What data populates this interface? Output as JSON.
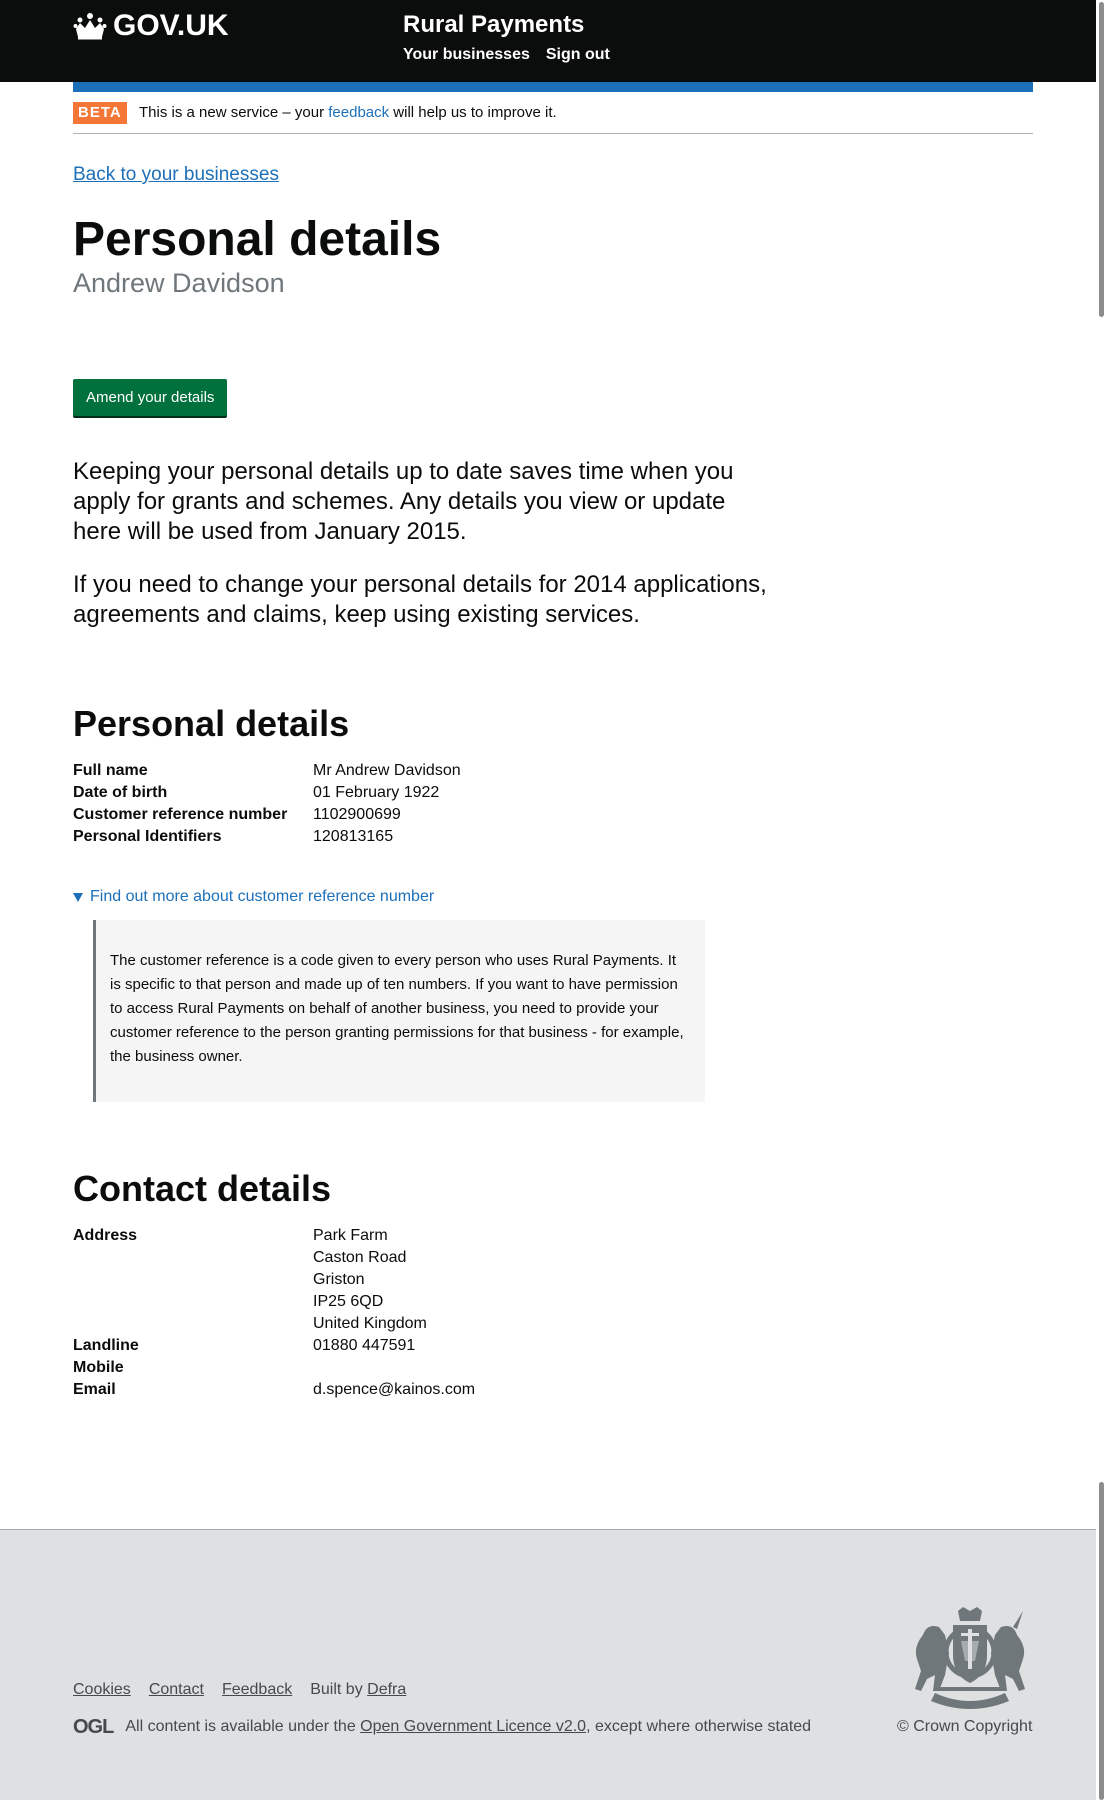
{
  "header": {
    "logo_text": "GOV.UK",
    "logo_icon": "crown-icon",
    "service_name": "Rural Payments",
    "nav": [
      "Your businesses",
      "Sign out"
    ]
  },
  "phase_banner": {
    "tag": "BETA",
    "message_before": "This is a new service – your ",
    "feedback_link": "feedback",
    "message_after": " will help us to improve it."
  },
  "back_link": "Back to your businesses",
  "page": {
    "title": "Personal details",
    "caption": "Andrew Davidson",
    "amend_button": "Amend your details",
    "lead_1": "Keeping your personal details up to date saves time when you apply for grants and schemes. Any details you view or update here will be used from January 2015.",
    "lead_2": "If you need to change your personal details for 2014 applications, agreements and claims, keep using existing services."
  },
  "personal_details": {
    "heading": "Personal details",
    "rows": [
      {
        "label": "Full name",
        "value": "Mr Andrew Davidson"
      },
      {
        "label": "Date of birth",
        "value": "01 February 1922"
      },
      {
        "label": "Customer reference number",
        "value": "1102900699"
      },
      {
        "label": "Personal Identifiers",
        "value": "120813165"
      }
    ],
    "details_summary": "Find out more about customer reference number",
    "details_text": "The customer reference is a code given to every person who uses Rural Payments. It is specific to that person and made up of ten numbers. If you want to have permission to access Rural Payments on behalf of another business, you need to provide your customer reference to the person granting permissions for that business - for example, the business owner."
  },
  "contact_details": {
    "heading": "Contact details",
    "address_label": "Address",
    "address_lines": [
      "Park Farm",
      "Caston Road",
      "Griston",
      "IP25 6QD",
      "United Kingdom"
    ],
    "landline_label": "Landline",
    "landline": "01880 447591",
    "mobile_label": "Mobile",
    "mobile": "",
    "email_label": "Email",
    "email": "d.spence@kainos.com"
  },
  "footer": {
    "links": [
      "Cookies",
      "Contact",
      "Feedback"
    ],
    "built_by": "Built by ",
    "built_by_link": "Defra",
    "ogl_logo": "OGL",
    "licence_before": "All content is available under the ",
    "licence_link": "Open Government Licence v2.0",
    "licence_after": ", except where otherwise stated",
    "copyright": "© Crown Copyright",
    "crest_icon": "royal-coat-of-arms-icon"
  }
}
